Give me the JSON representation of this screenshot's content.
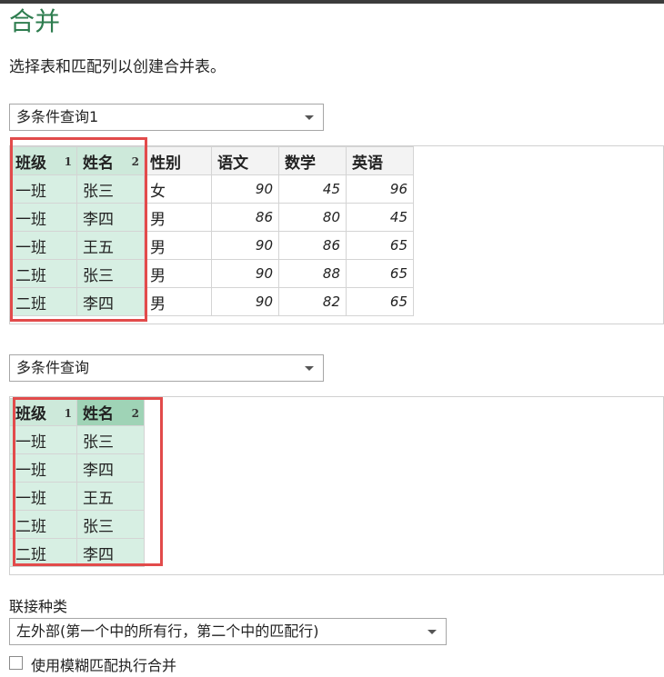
{
  "dialog": {
    "title": "合并",
    "instruction": "选择表和匹配列以创建合并表。"
  },
  "table1": {
    "select_value": "多条件查询1",
    "headers": [
      "班级",
      "姓名",
      "性别",
      "语文",
      "数学",
      "英语"
    ],
    "match_index": [
      "1",
      "2"
    ],
    "rows": [
      [
        "一班",
        "张三",
        "女",
        "90",
        "45",
        "96"
      ],
      [
        "一班",
        "李四",
        "男",
        "86",
        "80",
        "45"
      ],
      [
        "一班",
        "王五",
        "男",
        "90",
        "86",
        "65"
      ],
      [
        "二班",
        "张三",
        "男",
        "90",
        "88",
        "65"
      ],
      [
        "二班",
        "李四",
        "男",
        "90",
        "82",
        "65"
      ]
    ]
  },
  "table2": {
    "select_value": "多条件查询",
    "headers": [
      "班级",
      "姓名"
    ],
    "match_index": [
      "1",
      "2"
    ],
    "rows": [
      [
        "一班",
        "张三"
      ],
      [
        "一班",
        "李四"
      ],
      [
        "一班",
        "王五"
      ],
      [
        "二班",
        "张三"
      ],
      [
        "二班",
        "李四"
      ]
    ]
  },
  "join": {
    "label": "联接种类",
    "select_value": "左外部(第一个中的所有行，第二个中的匹配行)",
    "fuzzy_checkbox_label": "使用模糊匹配执行合并",
    "fuzzy_checked": false
  },
  "colors": {
    "title": "#2e7d4f",
    "selected_column": "#d7efe3",
    "highlight_box": "#e24b4b"
  }
}
